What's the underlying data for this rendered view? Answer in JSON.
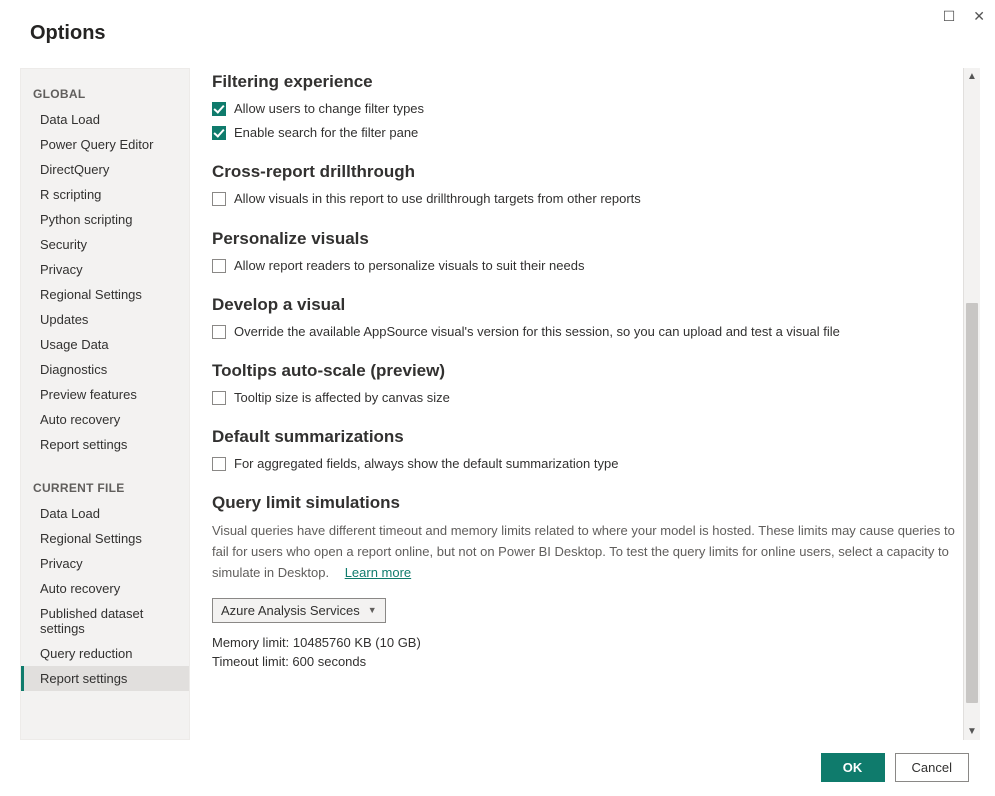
{
  "window": {
    "title": "Options"
  },
  "sidebar": {
    "section1_header": "GLOBAL",
    "section1_items": [
      "Data Load",
      "Power Query Editor",
      "DirectQuery",
      "R scripting",
      "Python scripting",
      "Security",
      "Privacy",
      "Regional Settings",
      "Updates",
      "Usage Data",
      "Diagnostics",
      "Preview features",
      "Auto recovery",
      "Report settings"
    ],
    "section2_header": "CURRENT FILE",
    "section2_items": [
      "Data Load",
      "Regional Settings",
      "Privacy",
      "Auto recovery",
      "Published dataset settings",
      "Query reduction",
      "Report settings"
    ],
    "selected_section": 2,
    "selected_index": 6
  },
  "content": {
    "filtering": {
      "heading": "Filtering experience",
      "opt1": {
        "label": "Allow users to change filter types",
        "checked": true
      },
      "opt2": {
        "label": "Enable search for the filter pane",
        "checked": true
      }
    },
    "crossreport": {
      "heading": "Cross-report drillthrough",
      "opt1": {
        "label": "Allow visuals in this report to use drillthrough targets from other reports",
        "checked": false
      }
    },
    "personalize": {
      "heading": "Personalize visuals",
      "opt1": {
        "label": "Allow report readers to personalize visuals to suit their needs",
        "checked": false
      }
    },
    "develop": {
      "heading": "Develop a visual",
      "opt1": {
        "label": "Override the available AppSource visual's version for this session, so you can upload and test a visual file",
        "checked": false
      }
    },
    "tooltips": {
      "heading": "Tooltips auto-scale (preview)",
      "opt1": {
        "label": "Tooltip size is affected by canvas size",
        "checked": false
      }
    },
    "defsumm": {
      "heading": "Default summarizations",
      "opt1": {
        "label": "For aggregated fields, always show the default summarization type",
        "checked": false
      }
    },
    "querylimit": {
      "heading": "Query limit simulations",
      "description": "Visual queries have different timeout and memory limits related to where your model is hosted. These limits may cause queries to fail for users who open a report online, but not on Power BI Desktop. To test the query limits for online users, select a capacity to simulate in Desktop.",
      "learn_more": "Learn more",
      "dropdown_value": "Azure Analysis Services",
      "memory_line": "Memory limit: 10485760 KB (10 GB)",
      "timeout_line": "Timeout limit: 600 seconds"
    }
  },
  "footer": {
    "ok": "OK",
    "cancel": "Cancel"
  }
}
